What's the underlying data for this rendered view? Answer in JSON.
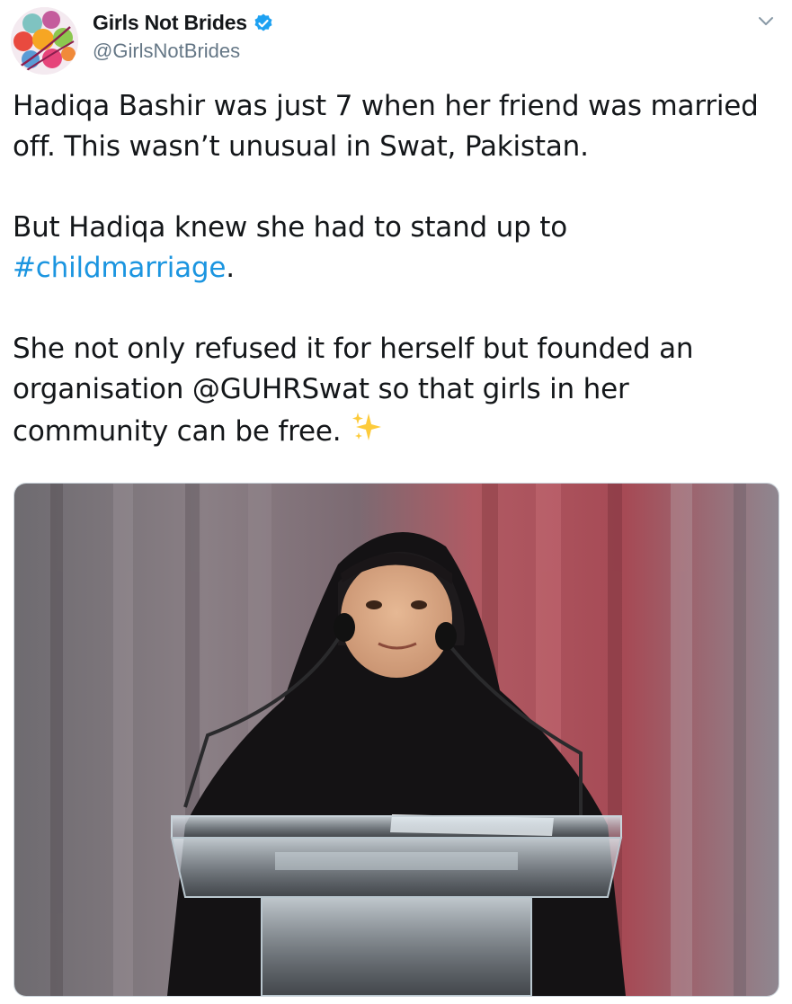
{
  "tweet": {
    "author": {
      "display_name": "Girls Not Brides",
      "handle": "@GirlsNotBrides",
      "verified": true,
      "avatar_icon": "girls-not-brides-logo"
    },
    "menu_icon": "chevron-down-icon",
    "text": {
      "paragraph1": "Hadiqa Bashir was just 7 when her friend was married off. This wasn’t unusual in Swat, Pakistan.",
      "paragraph2_before": "But Hadiqa knew she had to stand up to ",
      "paragraph2_hashtag": "#childmarriage",
      "paragraph2_after": ".",
      "paragraph3_before": "She not only refused it for herself but founded an organisation ",
      "paragraph3_mention": "@GUHRSwat",
      "paragraph3_after": " so that girls in her community can be free. ",
      "emoji": "sparkles-emoji"
    },
    "media": {
      "type": "photo",
      "description_icon": "speaker-at-podium-photo"
    },
    "colors": {
      "link": "#1b95e0",
      "text": "#14171a",
      "secondary": "#657786",
      "verified": "#1da1f2"
    }
  }
}
